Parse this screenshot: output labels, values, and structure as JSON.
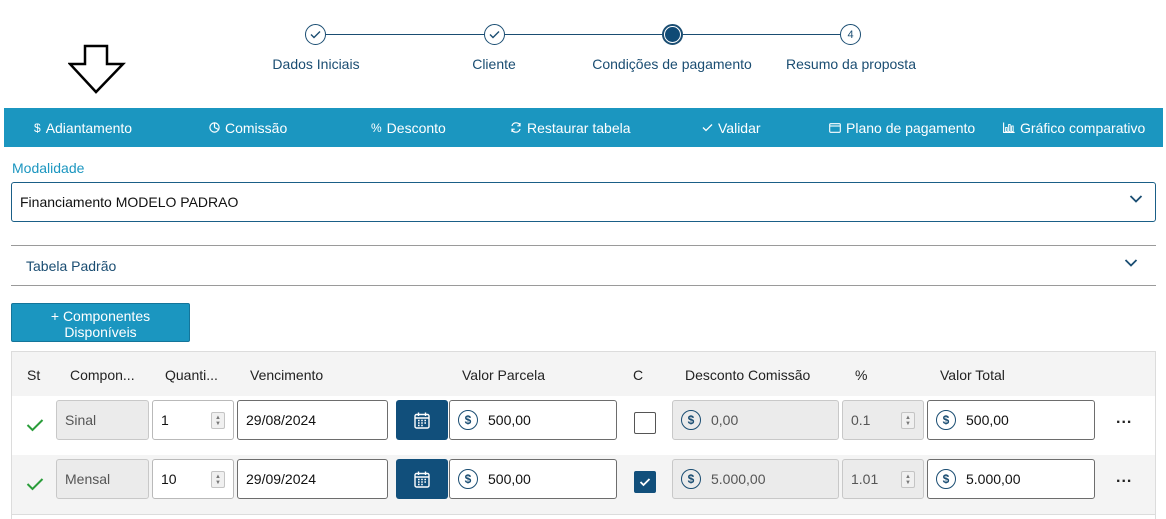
{
  "stepper": {
    "steps": [
      {
        "label": "Dados Iniciais",
        "state": "done",
        "number": ""
      },
      {
        "label": "Cliente",
        "state": "done",
        "number": ""
      },
      {
        "label": "Condições de pagamento",
        "state": "current",
        "number": ""
      },
      {
        "label": "Resumo da proposta",
        "state": "pending",
        "number": "4"
      }
    ]
  },
  "toolbar": {
    "items": [
      {
        "icon": "dollar-icon",
        "label": "Adiantamento"
      },
      {
        "icon": "commission-icon",
        "label": "Comissão"
      },
      {
        "icon": "percent-icon",
        "label": "Desconto"
      },
      {
        "icon": "refresh-icon",
        "label": "Restaurar tabela"
      },
      {
        "icon": "check-icon",
        "label": "Validar"
      },
      {
        "icon": "wallet-icon",
        "label": "Plano de pagamento"
      },
      {
        "icon": "bar-chart-icon",
        "label": "Gráfico comparativo"
      }
    ],
    "background": "#1b96c0"
  },
  "modalidade": {
    "label": "Modalidade",
    "value": "Financiamento MODELO PADRAO"
  },
  "tabela": {
    "label": "Tabela Padrão"
  },
  "components_button": {
    "label_line1": "+ Componentes",
    "label_line2": "Disponíveis"
  },
  "table": {
    "headers": [
      "St",
      "Compon...",
      "Quanti...",
      "Vencimento",
      "Valor Parcela",
      "C",
      "Desconto Comissão",
      "%",
      "Valor Total"
    ],
    "rows": [
      {
        "status": "ok",
        "componente": "Sinal",
        "quantidade": "1",
        "vencimento": "29/08/2024",
        "valor_parcela": "500,00",
        "checked": false,
        "desconto_comissao": "0,00",
        "percent": "0.1",
        "valor_total": "500,00"
      },
      {
        "status": "ok",
        "componente": "Mensal",
        "quantidade": "10",
        "vencimento": "29/09/2024",
        "valor_parcela": "500,00",
        "checked": true,
        "desconto_comissao": "5.000,00",
        "percent": "1.01",
        "valor_total": "5.000,00"
      }
    ],
    "more_label": "..."
  },
  "colors": {
    "primary": "#1b96c0",
    "dark_blue": "#114f7b",
    "step_color": "#1a4d72",
    "success": "#2a9d3a"
  }
}
